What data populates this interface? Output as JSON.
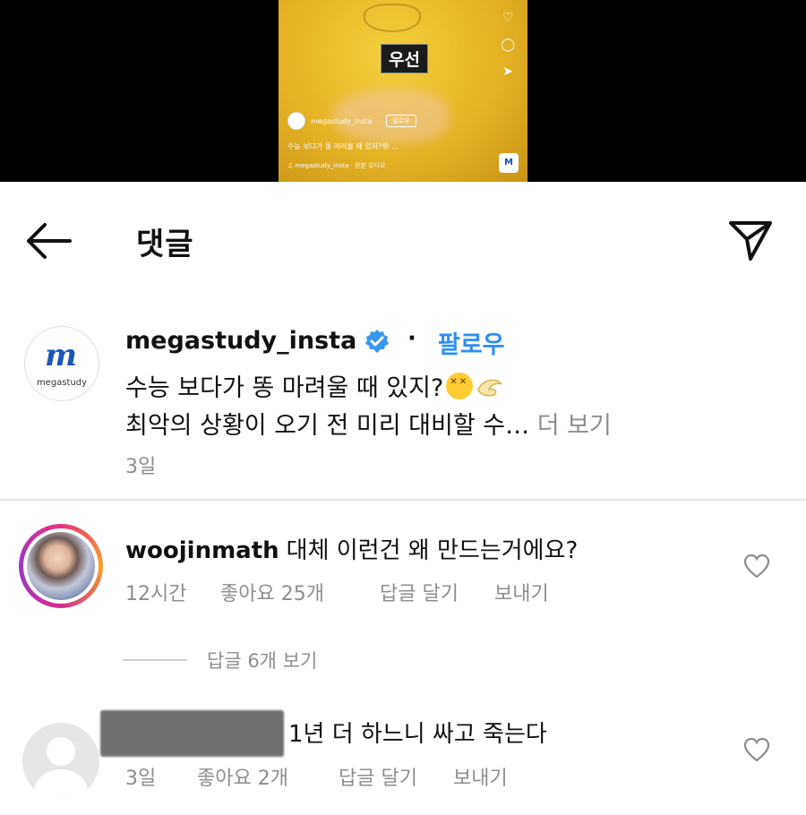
{
  "video": {
    "caption_box": "우선",
    "user": "megastudy_insta",
    "follow": "팔로우",
    "desc": "수능 보다가 똥 마려울 때 있지?😵 ...",
    "audio": "♫ megastudy_insta · 원본 오디오",
    "badge": "M"
  },
  "header": {
    "title": "댓글",
    "back_icon": "arrow-left-icon",
    "send_icon": "paper-plane-icon"
  },
  "caption_post": {
    "logo_text": "megastudy",
    "username": "megastudy_insta",
    "separator": "·",
    "follow_label": "팔로우",
    "line1": "수능 보다가 똥 마려울 때 있지?",
    "line2": "최악의 상황이 오기 전 미리 대비할 수…",
    "more_label": "더 보기",
    "time": "3일"
  },
  "comments": [
    {
      "username": "woojinmath",
      "text": "대체 이런건 왜 만드는거에요?",
      "time": "12시간",
      "likes": "좋아요 25개",
      "reply": "답글 달기",
      "send": "보내기"
    },
    {
      "username": "",
      "text": "1년 더 하느니 싸고 죽는다",
      "time": "3일",
      "likes": "좋아요 2개",
      "reply": "답글 달기",
      "send": "보내기"
    }
  ],
  "view_replies": "답글 6개 보기",
  "colors": {
    "accent": "#2f8ff0",
    "muted": "#8e8e8e",
    "verified": "#3897f0"
  }
}
